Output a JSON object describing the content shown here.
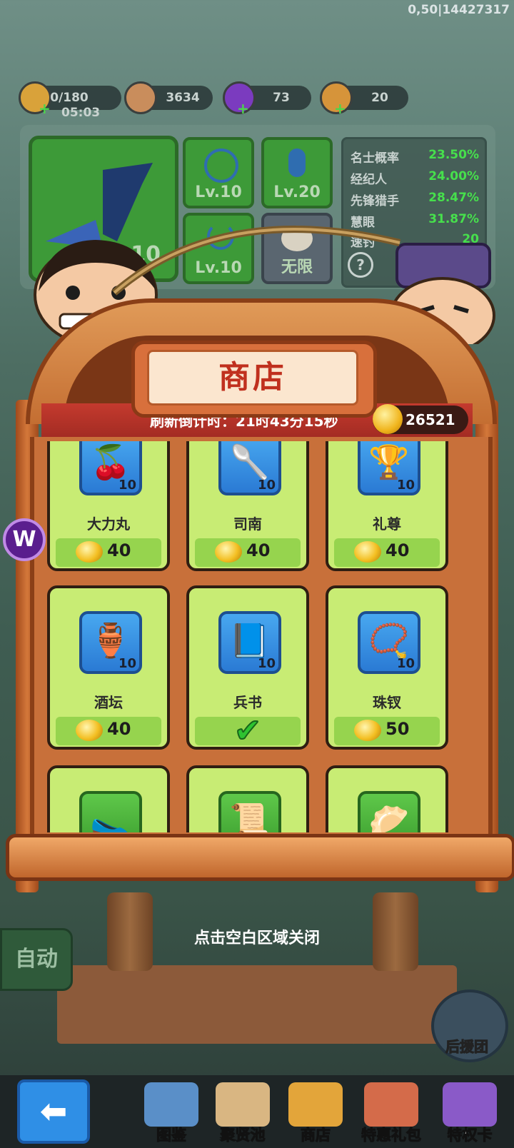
{
  "debug_label": "0,50|14427317",
  "resources": [
    {
      "value": "0/180",
      "sub": "05:03",
      "icon": "energy-scroll-icon",
      "color": "#d9a23a"
    },
    {
      "value": "3634",
      "icon": "copper-coin-icon",
      "color": "#c98d5c"
    },
    {
      "value": "73",
      "icon": "purple-gem-icon",
      "color": "#7b3bbf"
    },
    {
      "value": "20",
      "icon": "treasure-bag-icon",
      "color": "#d6943a"
    }
  ],
  "upgrade_panel": {
    "main_level": "10",
    "slots": [
      {
        "label": "Lv.10",
        "icon": "rope-lasso-icon"
      },
      {
        "label": "Lv.20",
        "icon": "fishing-float-icon"
      },
      {
        "label": "Lv.10",
        "icon": "hook-icon"
      },
      {
        "label": "无限",
        "icon": "bait-icon"
      }
    ],
    "stats": [
      {
        "name": "名士概率",
        "value": "23.50%"
      },
      {
        "name": "经纪人",
        "value": "24.00%"
      },
      {
        "name": "先锋猎手",
        "value": "28.47%"
      },
      {
        "name": "慧眼",
        "value": "31.87%"
      },
      {
        "name": "速钓",
        "value": "20"
      }
    ]
  },
  "shop": {
    "title": "商店",
    "refresh_timer": "刷新倒计时：21时43分15秒",
    "gold_balance": "26521",
    "items": [
      {
        "name": "大力丸",
        "count": "10",
        "price": "40",
        "icon": "pill-icon",
        "glyph": "🍒",
        "purchased": false
      },
      {
        "name": "司南",
        "count": "10",
        "price": "40",
        "icon": "compass-spoon-icon",
        "glyph": "🥄",
        "purchased": false
      },
      {
        "name": "礼尊",
        "count": "10",
        "price": "40",
        "icon": "bronze-vessel-icon",
        "glyph": "🏆",
        "purchased": false
      },
      {
        "name": "酒坛",
        "count": "10",
        "price": "40",
        "icon": "wine-jar-icon",
        "glyph": "🏺",
        "purchased": false
      },
      {
        "name": "兵书",
        "count": "10",
        "price": "",
        "icon": "war-book-icon",
        "glyph": "📘",
        "purchased": true
      },
      {
        "name": "珠钗",
        "count": "10",
        "price": "50",
        "icon": "hairpin-icon",
        "glyph": "📿",
        "purchased": false
      },
      {
        "name": "",
        "count": "",
        "price": "",
        "icon": "straw-sandal-icon",
        "glyph": "🥿",
        "purchased": false
      },
      {
        "name": "",
        "count": "",
        "price": "",
        "icon": "scroll-icon",
        "glyph": "📜",
        "purchased": false
      },
      {
        "name": "",
        "count": "",
        "price": "",
        "icon": "bun-icon",
        "glyph": "🥟",
        "purchased": false
      }
    ],
    "close_hint": "点击空白区域关闭"
  },
  "side": {
    "auto_label": "自动",
    "helper_label": "后援团",
    "badge_letter": "W"
  },
  "bottom_nav": [
    {
      "label": "图鉴",
      "icon": "codex-book-icon",
      "color": "#5a8fc8"
    },
    {
      "label": "聚贤池",
      "icon": "recruit-map-icon",
      "color": "#d9b682"
    },
    {
      "label": "商店",
      "icon": "shop-treasure-icon",
      "color": "#e3a53a"
    },
    {
      "label": "特惠礼包",
      "icon": "gift-pack-icon",
      "color": "#d46b4a"
    },
    {
      "label": "特权卡",
      "icon": "privilege-card-icon",
      "color": "#8a5ac8"
    }
  ]
}
